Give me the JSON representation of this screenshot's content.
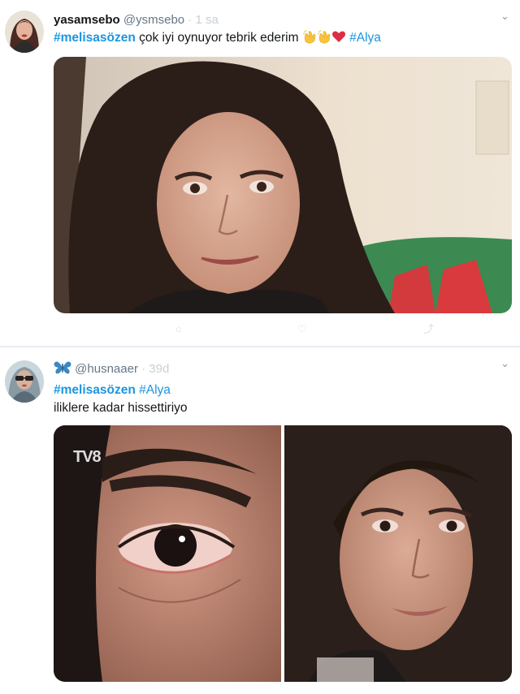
{
  "tweets": [
    {
      "display_name": "yasamsebo",
      "handle": "@ysmsebo",
      "separator": " · ",
      "time": "1 sa",
      "text_hashtag": "#melisasözen",
      "text_body": " çok iyi oynuyor tebrik ederim ",
      "text_emoji": [
        "clapping-hands",
        "clapping-hands",
        "red-heart"
      ],
      "text_hashtag2": " #Alya",
      "image": "woman-smiling-red-eyes"
    },
    {
      "verified_icon": "butterfly",
      "handle": "@husnaaer",
      "separator": " · ",
      "time": "39d",
      "text_hashtag": "#melisasözen",
      "text_hashtag2": " #Alya",
      "text_line2": "iliklere kadar hissettiriyo",
      "images": [
        "close-up-eye",
        "woman-tearful"
      ],
      "watermark": "TV8"
    }
  ],
  "colors": {
    "link": "#1b95e0",
    "text": "#14171a",
    "muted": "#657786",
    "divider": "#e6ecf0"
  }
}
